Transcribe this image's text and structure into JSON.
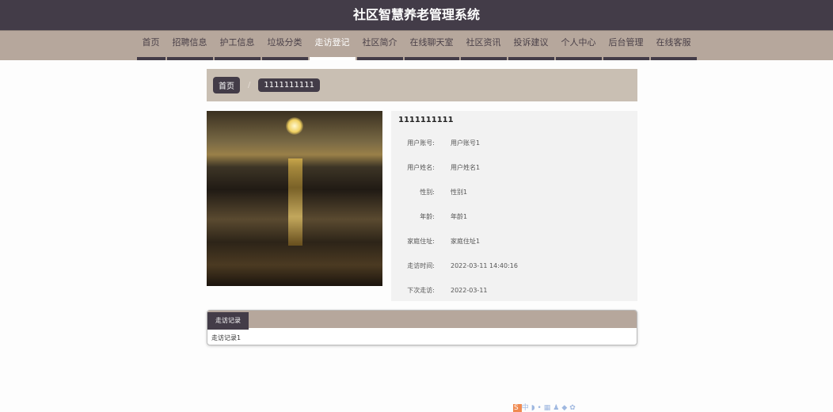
{
  "header": {
    "title": "社区智慧养老管理系统"
  },
  "nav": {
    "items": [
      "首页",
      "招聘信息",
      "护工信息",
      "垃圾分类",
      "走访登记",
      "社区简介",
      "在线聊天室",
      "社区资讯",
      "投诉建议",
      "个人中心",
      "后台管理",
      "在线客服"
    ],
    "active": "走访登记"
  },
  "breadcrumb": {
    "home": "首页",
    "separator": "/",
    "current": "1111111111"
  },
  "detail": {
    "title": "1111111111",
    "fields": [
      {
        "label": "用户账号:",
        "value": "用户账号1"
      },
      {
        "label": "用户姓名:",
        "value": "用户姓名1"
      },
      {
        "label": "性别:",
        "value": "性别1"
      },
      {
        "label": "年龄:",
        "value": "年龄1"
      },
      {
        "label": "家庭住址:",
        "value": "家庭住址1"
      },
      {
        "label": "走访时间:",
        "value": "2022-03-11 14:40:16"
      },
      {
        "label": "下次走访:",
        "value": "2022-03-11"
      }
    ]
  },
  "tabs": {
    "label": "走访记录",
    "content": "走访记录1"
  },
  "tray": {
    "ime": "中"
  }
}
